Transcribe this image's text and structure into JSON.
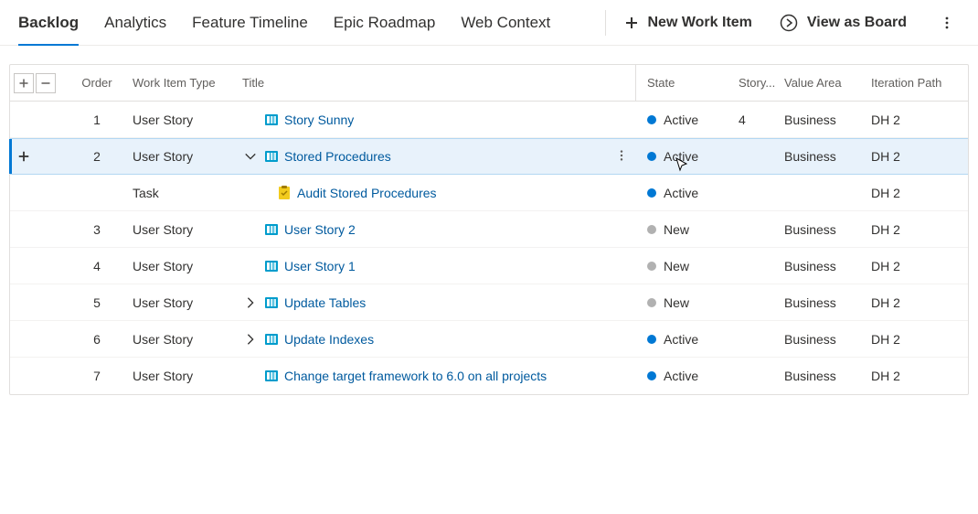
{
  "header": {
    "tabs": [
      "Backlog",
      "Analytics",
      "Feature Timeline",
      "Epic Roadmap",
      "Web Context"
    ],
    "active_tab": 0,
    "new_work_item_label": "New Work Item",
    "view_as_board_label": "View as Board"
  },
  "columns": {
    "order": "Order",
    "type": "Work Item Type",
    "title": "Title",
    "state": "State",
    "story": "Story...",
    "value": "Value Area",
    "iter": "Iteration Path"
  },
  "rows": [
    {
      "order": "1",
      "type": "User Story",
      "title": "Story Sunny",
      "icon": "story",
      "chevron": "none",
      "state": "Active",
      "state_kind": "active",
      "story": "4",
      "value": "Business",
      "iter": "DH 2",
      "selected": false,
      "child": false
    },
    {
      "order": "2",
      "type": "User Story",
      "title": "Stored Procedures",
      "icon": "story",
      "chevron": "down",
      "state": "Active",
      "state_kind": "active",
      "story": "",
      "value": "Business",
      "iter": "DH 2",
      "selected": true,
      "child": false
    },
    {
      "order": "",
      "type": "Task",
      "title": "Audit Stored Procedures",
      "icon": "task",
      "chevron": "none",
      "state": "Active",
      "state_kind": "active",
      "story": "",
      "value": "",
      "iter": "DH 2",
      "selected": false,
      "child": true
    },
    {
      "order": "3",
      "type": "User Story",
      "title": "User Story 2",
      "icon": "story",
      "chevron": "none",
      "state": "New",
      "state_kind": "new",
      "story": "",
      "value": "Business",
      "iter": "DH 2",
      "selected": false,
      "child": false
    },
    {
      "order": "4",
      "type": "User Story",
      "title": "User Story 1",
      "icon": "story",
      "chevron": "none",
      "state": "New",
      "state_kind": "new",
      "story": "",
      "value": "Business",
      "iter": "DH 2",
      "selected": false,
      "child": false
    },
    {
      "order": "5",
      "type": "User Story",
      "title": "Update Tables",
      "icon": "story",
      "chevron": "right",
      "state": "New",
      "state_kind": "new",
      "story": "",
      "value": "Business",
      "iter": "DH 2",
      "selected": false,
      "child": false
    },
    {
      "order": "6",
      "type": "User Story",
      "title": "Update Indexes",
      "icon": "story",
      "chevron": "right",
      "state": "Active",
      "state_kind": "active",
      "story": "",
      "value": "Business",
      "iter": "DH 2",
      "selected": false,
      "child": false
    },
    {
      "order": "7",
      "type": "User Story",
      "title": "Change target framework to 6.0 on all projects",
      "icon": "story",
      "chevron": "none",
      "state": "Active",
      "state_kind": "active",
      "story": "",
      "value": "Business",
      "iter": "DH 2",
      "selected": false,
      "child": false
    }
  ]
}
